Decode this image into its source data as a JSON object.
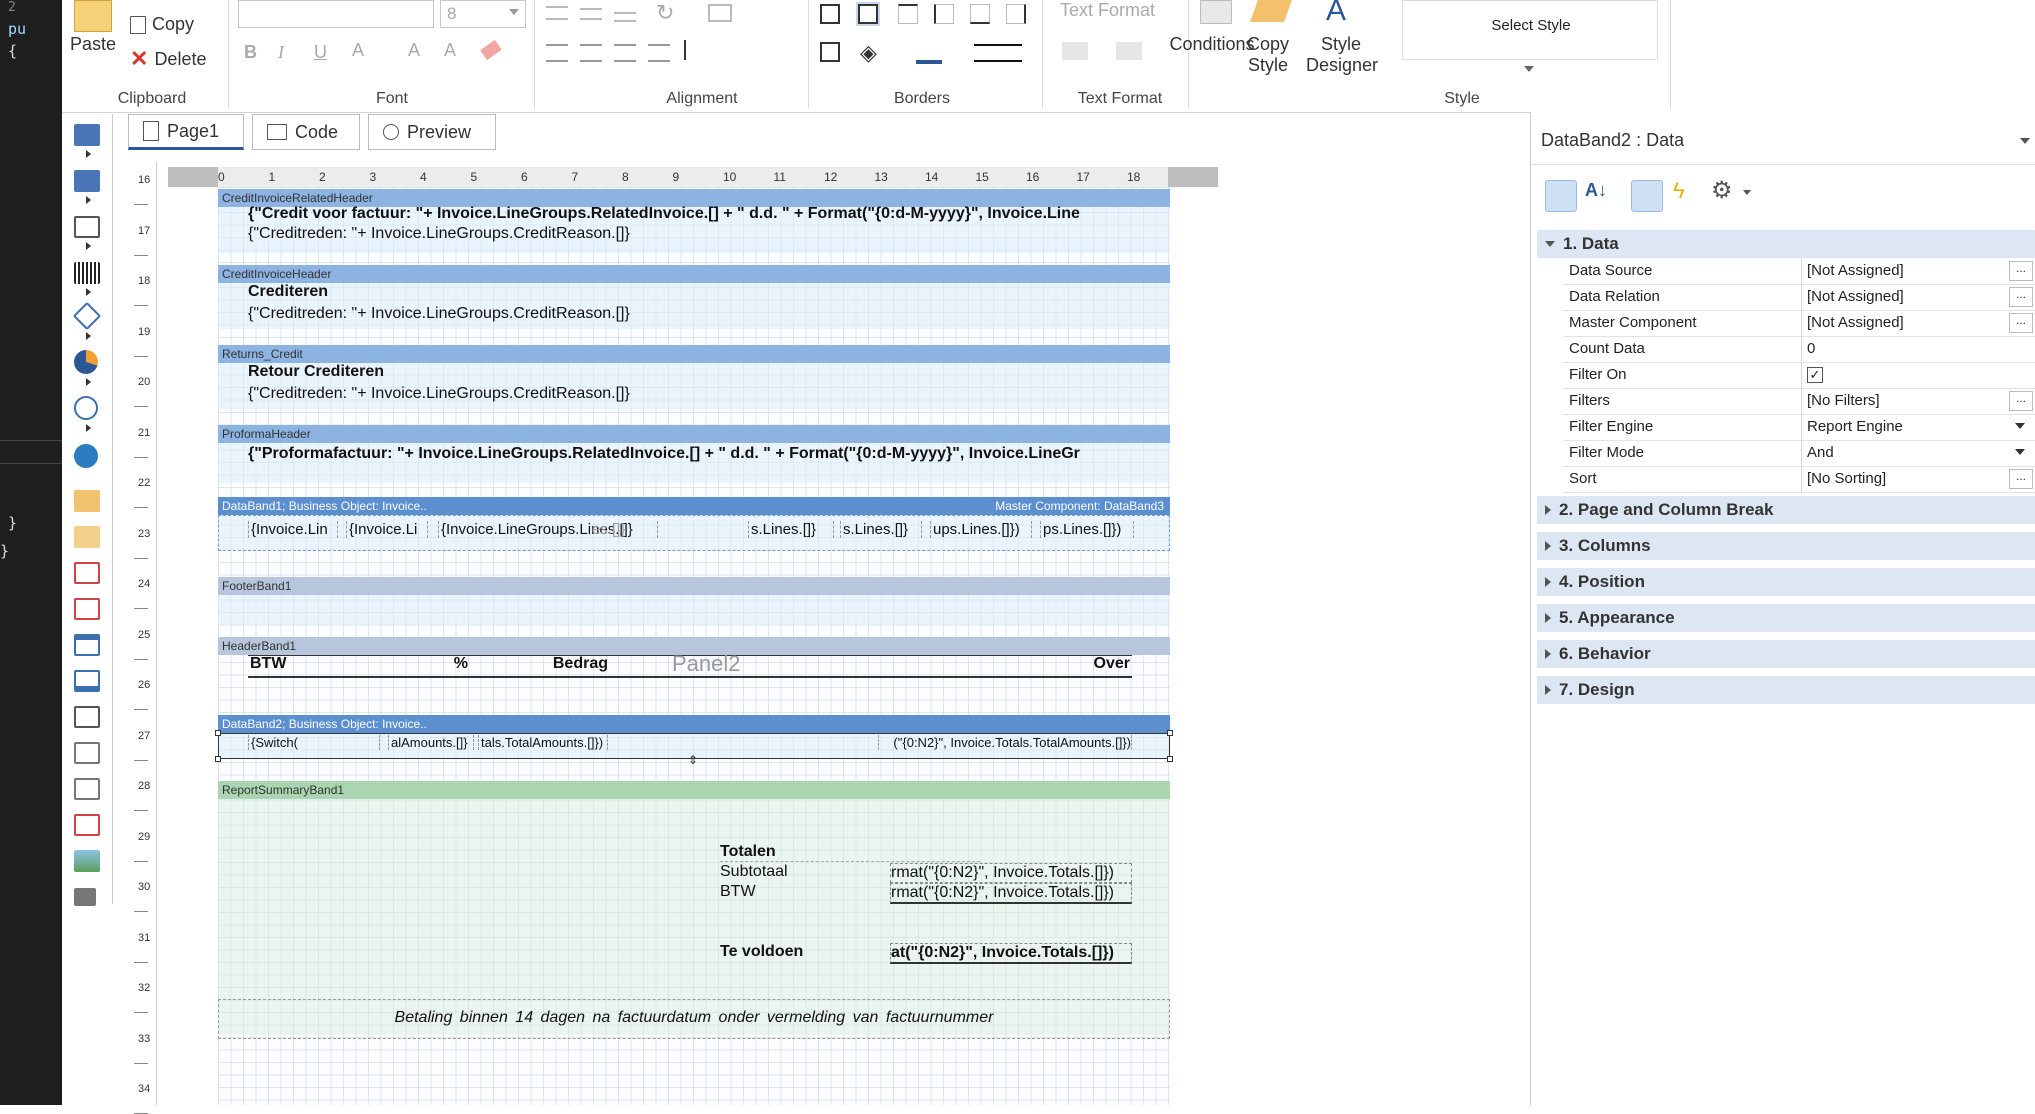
{
  "code_strip": {
    "lines": [
      "2",
      "pu",
      "{",
      "}",
      "}"
    ]
  },
  "ribbon": {
    "clipboard": {
      "paste": "Paste",
      "copy": "Copy",
      "delete": "Delete",
      "label": "Clipboard"
    },
    "font": {
      "name_value": "",
      "size_value": "8",
      "label": "Font"
    },
    "alignment": {
      "label": "Alignment"
    },
    "borders": {
      "label": "Borders"
    },
    "text_format": {
      "combo": "Text Format",
      "label": "Text Format"
    },
    "style": {
      "conditions": "Conditions",
      "copy_style_1": "Copy",
      "copy_style_2": "Style",
      "designer_1": "Style",
      "designer_2": "Designer",
      "select_style": "Select Style",
      "label": "Style"
    }
  },
  "tabs": [
    {
      "label": "Page1"
    },
    {
      "label": "Code"
    },
    {
      "label": "Preview"
    }
  ],
  "rulers": {
    "vertical": [
      "16",
      "17",
      "18",
      "19",
      "20",
      "21",
      "22",
      "23",
      "24",
      "25",
      "26",
      "27",
      "28",
      "29",
      "30",
      "31",
      "32",
      "33",
      "34"
    ],
    "horizontal": [
      "0",
      "1",
      "2",
      "3",
      "4",
      "5",
      "6",
      "7",
      "8",
      "9",
      "10",
      "11",
      "12",
      "13",
      "14",
      "15",
      "16",
      "17",
      "18"
    ]
  },
  "bands": {
    "credit_related": {
      "title": "CreditInvoiceRelatedHeader",
      "line1": "{\"Credit voor factuur: \"+ Invoice.LineGroups.RelatedInvoice.[] + \" d.d. \" + Format(\"{0:d-M-yyyy}\", Invoice.Line",
      "line2": "{\"Creditreden: \"+ Invoice.LineGroups.CreditReason.[]}"
    },
    "credit_header": {
      "title": "CreditInvoiceHeader",
      "line1": "Crediteren",
      "line2": "{\"Creditreden: \"+ Invoice.LineGroups.CreditReason.[]}"
    },
    "returns_credit": {
      "title": "Returns_Credit",
      "line1": "Retour Crediteren",
      "line2": "{\"Creditreden: \"+ Invoice.LineGroups.CreditReason.[]}"
    },
    "proforma": {
      "title": "ProformaHeader",
      "line1": "{\"Proformafactuur: \"+ Invoice.LineGroups.RelatedInvoice.[] + \" d.d. \" + Format(\"{0:d-M-yyyy}\", Invoice.LineGr"
    },
    "databand1": {
      "title": "DataBand1; Business Object: Invoice..",
      "master": "Master Component: DataBand3",
      "cells": [
        "{Invoice.Lin",
        "{Invoice.Li",
        "{Invoice.LineGroups.Lines.[]}",
        "s.Lines.[]}",
        "s.Lines.[]}",
        "ups.Lines.[]})",
        "ps.Lines.[]})"
      ],
      "ghost": "es.[]}"
    },
    "footer1": {
      "title": "FooterBand1"
    },
    "header1": {
      "title": "HeaderBand1",
      "btw": "BTW",
      "pct": "%",
      "bedrag": "Bedrag",
      "panel": "Panel2",
      "over": "Over"
    },
    "databand2": {
      "title": "DataBand2; Business Object: Invoice..",
      "cells": [
        "{Switch(",
        "alAmounts.[]}",
        "tals.TotalAmounts.[]})",
        "(\"{0:N2}\", Invoice.Totals.TotalAmounts.[]})"
      ]
    },
    "summary": {
      "title": "ReportSummaryBand1",
      "totalen": "Totalen",
      "subtotaal": "Subtotaal",
      "btw": "BTW",
      "sub_val": "rmat(\"{0:N2}\", Invoice.Totals.[]})",
      "btw_val": "rmat(\"{0:N2}\", Invoice.Totals.[]})",
      "te_voldoen": "Te voldoen",
      "tv_val": "at(\"{0:N2}\", Invoice.Totals.[]})",
      "footer_note": "Betaling binnen 14 dagen na factuurdatum onder vermelding van factuurnummer"
    }
  },
  "properties": {
    "title": "DataBand2 : Data",
    "cat1": "1. Data",
    "rows": [
      {
        "key": "Data Source",
        "value": "[Not Assigned]"
      },
      {
        "key": "Data Relation",
        "value": "[Not Assigned]"
      },
      {
        "key": "Master Component",
        "value": "[Not Assigned]"
      },
      {
        "key": "Count Data",
        "value": "0"
      },
      {
        "key": "Filter On",
        "value": "✓"
      },
      {
        "key": "Filters",
        "value": "[No Filters]"
      },
      {
        "key": "Filter Engine",
        "value": "Report Engine"
      },
      {
        "key": "Filter Mode",
        "value": "And"
      },
      {
        "key": "Sort",
        "value": "[No Sorting]"
      }
    ],
    "dots": "...",
    "cats": [
      "2. Page and  Column  Break",
      "3. Columns",
      "4. Position",
      "5. Appearance",
      "6. Behavior",
      "7. Design"
    ]
  },
  "colors": {
    "band_blue": "#8db3e2",
    "band_mid": "#5b8fcf",
    "band_grey": "#b7c6dd",
    "band_green": "#a9d5b0",
    "accent": "#2b5797"
  }
}
